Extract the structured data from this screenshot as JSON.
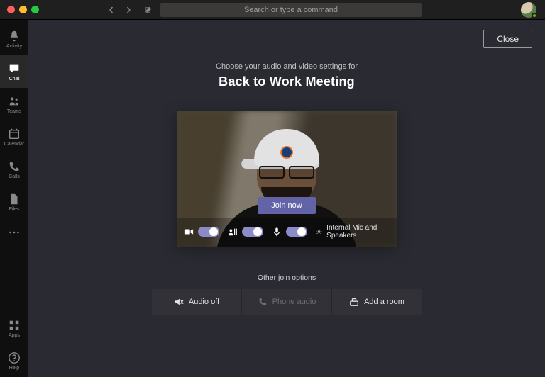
{
  "search": {
    "placeholder": "Search or type a command"
  },
  "rail": {
    "items": [
      {
        "id": "activity",
        "label": "Activity"
      },
      {
        "id": "chat",
        "label": "Chat"
      },
      {
        "id": "teams",
        "label": "Teams"
      },
      {
        "id": "calendar",
        "label": "Calendar"
      },
      {
        "id": "calls",
        "label": "Calls"
      },
      {
        "id": "files",
        "label": "Files"
      }
    ],
    "bottom": [
      {
        "id": "apps",
        "label": "Apps"
      },
      {
        "id": "help",
        "label": "Help"
      }
    ],
    "active_id": "chat"
  },
  "buttons": {
    "close": "Close",
    "join": "Join now"
  },
  "prejoin": {
    "subheading": "Choose your audio and video settings for",
    "title": "Back to Work Meeting",
    "devices_label": "Internal Mic and Speakers",
    "video_on": true,
    "bg_effects_on": true,
    "mic_on": true
  },
  "other_options": {
    "heading": "Other join options",
    "items": [
      {
        "id": "audio-off",
        "icon": "speaker-off-icon",
        "label": "Audio off",
        "disabled": false
      },
      {
        "id": "phone-audio",
        "icon": "phone-icon",
        "label": "Phone audio",
        "disabled": true
      },
      {
        "id": "add-room",
        "icon": "room-icon",
        "label": "Add a room",
        "disabled": false
      }
    ]
  },
  "colors": {
    "accent": "#6264a7",
    "panel_bg": "#2a2a32",
    "rail_bg": "#0f0f0f"
  }
}
